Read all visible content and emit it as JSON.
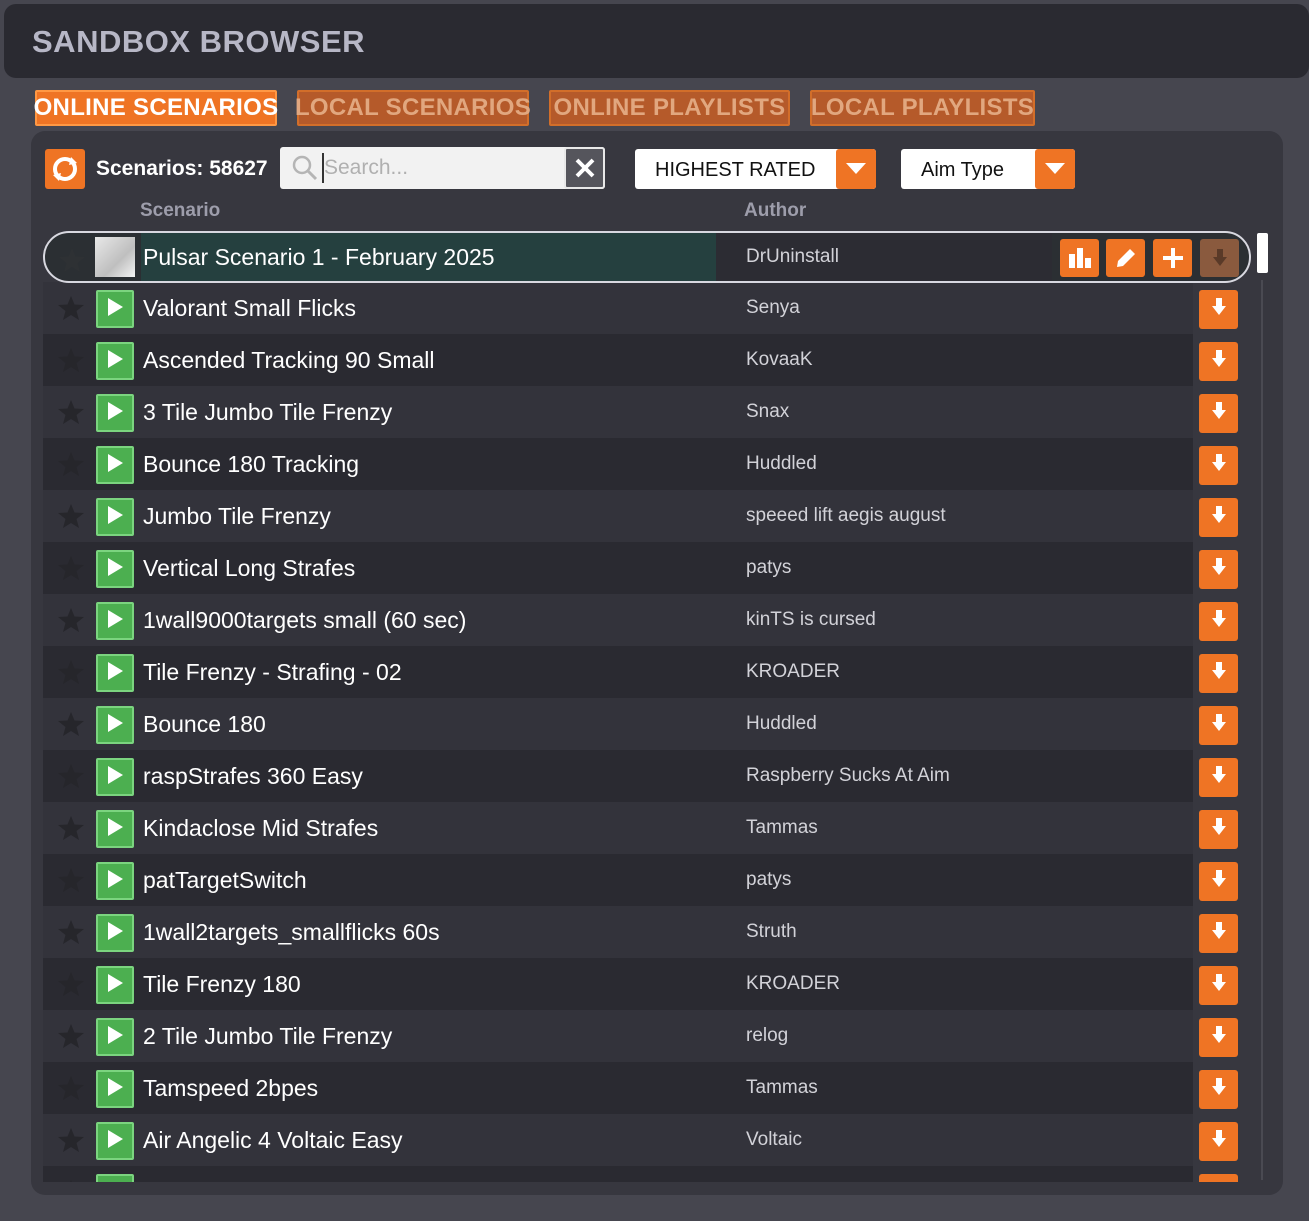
{
  "window": {
    "title": "SANDBOX BROWSER"
  },
  "tabs": [
    {
      "label": "ONLINE SCENARIOS",
      "active": true
    },
    {
      "label": "LOCAL SCENARIOS",
      "active": false
    },
    {
      "label": "ONLINE  PLAYLISTS",
      "active": false
    },
    {
      "label": "LOCAL PLAYLISTS",
      "active": false
    }
  ],
  "toolbar": {
    "refresh_icon": "refresh-icon",
    "count_label": "Scenarios: 58627",
    "search_placeholder": "Search...",
    "search_value": "",
    "sort_value": "HIGHEST RATED",
    "filter_value": "Aim Type"
  },
  "columns": {
    "scenario": "Scenario",
    "author": "Author"
  },
  "selected_row": {
    "name": "Pulsar Scenario 1 - February 2025",
    "author": "DrUninstall",
    "actions": [
      "leaderboard-icon",
      "edit-icon",
      "add-icon",
      "download-icon"
    ]
  },
  "rows": [
    {
      "name": "Valorant Small Flicks",
      "author": "Senya"
    },
    {
      "name": "Ascended Tracking 90 Small",
      "author": "KovaaK"
    },
    {
      "name": "3 Tile Jumbo Tile Frenzy",
      "author": "Snax"
    },
    {
      "name": "Bounce 180 Tracking",
      "author": "Huddled"
    },
    {
      "name": "Jumbo Tile Frenzy",
      "author": "speeed lift aegis august"
    },
    {
      "name": "Vertical Long Strafes",
      "author": "patys"
    },
    {
      "name": "1wall9000targets small (60 sec)",
      "author": "kinTS is cursed"
    },
    {
      "name": "Tile Frenzy - Strafing - 02",
      "author": "KROADER"
    },
    {
      "name": "Bounce 180",
      "author": "Huddled"
    },
    {
      "name": "raspStrafes 360 Easy",
      "author": "Raspberry Sucks At Aim"
    },
    {
      "name": "Kindaclose Mid Strafes",
      "author": "Tammas"
    },
    {
      "name": "patTargetSwitch",
      "author": "patys"
    },
    {
      "name": "1wall2targets_smallflicks 60s",
      "author": "Struth"
    },
    {
      "name": "Tile Frenzy 180",
      "author": "KROADER"
    },
    {
      "name": "2 Tile Jumbo Tile Frenzy",
      "author": "relog"
    },
    {
      "name": "Tamspeed 2bpes",
      "author": "Tammas"
    },
    {
      "name": "Air Angelic 4 Voltaic Easy",
      "author": "Voltaic"
    }
  ],
  "colors": {
    "accent": "#ef7424",
    "play": "#4caf50",
    "background": "#46464f",
    "panel": "#37373f"
  }
}
